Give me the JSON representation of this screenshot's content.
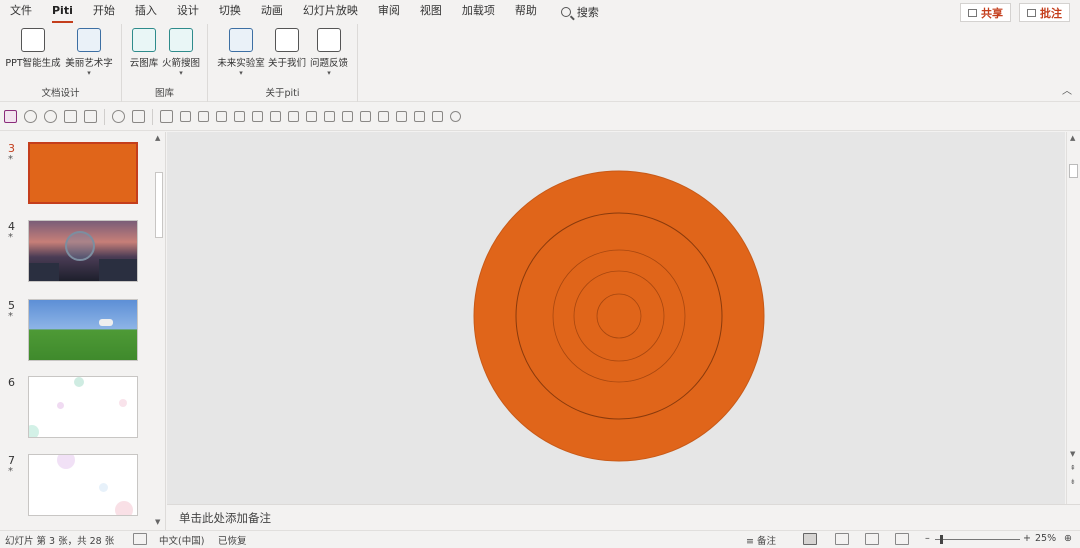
{
  "menu": {
    "tabs": [
      "文件",
      "Piti",
      "开始",
      "插入",
      "设计",
      "切换",
      "动画",
      "幻灯片放映",
      "审阅",
      "视图",
      "加载项",
      "帮助"
    ],
    "active_tab": "Piti",
    "search_label": "搜索",
    "share_label": "共享",
    "comment_label": "批注"
  },
  "ribbon": {
    "groups": [
      {
        "title": "文档设计",
        "buttons": [
          {
            "label": "PPT智能生成",
            "icon": "document-icon"
          },
          {
            "label": "美丽艺术字",
            "icon": "art-text-icon"
          }
        ]
      },
      {
        "title": "图库",
        "buttons": [
          {
            "label": "云图库",
            "icon": "cloud-gallery-icon"
          },
          {
            "label": "火箭搜图",
            "icon": "rocket-search-icon"
          }
        ]
      },
      {
        "title": "关于piti",
        "buttons": [
          {
            "label": "未来实验室",
            "icon": "lab-flask-icon"
          },
          {
            "label": "关于我们",
            "icon": "about-icon"
          },
          {
            "label": "问题反馈",
            "icon": "feedback-icon"
          }
        ]
      }
    ]
  },
  "thumbnails": [
    {
      "num": "3",
      "star": "*",
      "selected": true,
      "style": "orange-slide"
    },
    {
      "num": "4",
      "star": "*",
      "selected": false,
      "style": "night-city-slide"
    },
    {
      "num": "5",
      "star": "*",
      "selected": false,
      "style": "grass-sheep-slide"
    },
    {
      "num": "6",
      "star": "",
      "selected": false,
      "style": "bubbles-slide"
    },
    {
      "num": "7",
      "star": "*",
      "selected": false,
      "style": "bubbles-slide"
    }
  ],
  "canvas": {
    "background": "#e6e6e6",
    "shape_color": "#e0651a",
    "ring_color": "#8a3a0c"
  },
  "notes": {
    "placeholder": "单击此处添加备注"
  },
  "status": {
    "slide_info": "幻灯片 第 3 张，共 28 张",
    "language": "中文(中国)",
    "recovered": "已恢复",
    "notes_button": "备注",
    "zoom": "25%"
  }
}
